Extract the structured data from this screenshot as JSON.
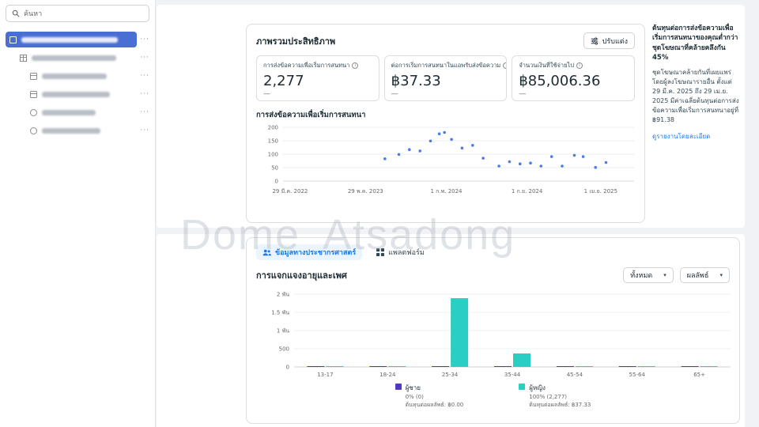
{
  "watermark": "Dome Atsadong",
  "colors": {
    "accent_blue": "#1877f2",
    "selected_row_blue": "#4a6fd4",
    "male_purple": "#5139bf",
    "female_teal": "#2bcec3"
  },
  "sidebar": {
    "search": {
      "placeholder": "ค้นหา"
    },
    "items": [
      {
        "icon": "folder-icon",
        "level": 0,
        "selected": true,
        "menu": "···"
      },
      {
        "icon": "grid-icon",
        "level": 1,
        "selected": false,
        "menu": "···"
      },
      {
        "icon": "adset-icon",
        "level": 2,
        "selected": false,
        "menu": "···"
      },
      {
        "icon": "adset-icon",
        "level": 2,
        "selected": false,
        "menu": "···"
      },
      {
        "icon": "ad-icon",
        "level": 2,
        "selected": false,
        "menu": "···"
      },
      {
        "icon": "ad-icon",
        "level": 2,
        "selected": false,
        "menu": "···"
      }
    ]
  },
  "performance": {
    "title": "ภาพรวมประสิทธิภาพ",
    "customize_button": "ปรับแต่ง",
    "metrics": [
      {
        "label": "การส่งข้อความเพื่อเริ่มการสนทนา",
        "value": "2,277",
        "secondary": "—"
      },
      {
        "label": "ต่อการเริ่มการสนทนาในแอพรับส่งข้อความ",
        "value": "฿37.33",
        "secondary": "—"
      },
      {
        "label": "จำนวนเงินที่ใช้จ่ายไป",
        "value": "฿85,006.36",
        "secondary": "—"
      }
    ],
    "chart_title": "การส่งข้อความเพื่อเริ่มการสนทนา"
  },
  "insight": {
    "headline": "ต้นทุนต่อการส่งข้อความเพื่อเริ่มการสนทนาของคุณต่ำกว่าชุดโฆษณาที่คล้ายคลึงกัน 45%",
    "body": "ชุดโฆษณาคล้ายกันที่เผยแพร่โดยผู้ลงโฆษณารายอื่น ตั้งแต่ 29 มี.ค. 2025 ถึง 29 เม.ย. 2025 มีค่าเฉลี่ยต้นทุนต่อการส่งข้อความเพื่อเริ่มการสนทนาอยู่ที่ ฿91.38",
    "link": "ดูรายงานโดยละเอียด"
  },
  "demographics": {
    "tabs": [
      {
        "label": "ข้อมูลทางประชากรศาสตร์",
        "active": true
      },
      {
        "label": "แพลตฟอร์ม",
        "active": false
      }
    ],
    "title": "การแจกแจงอายุและเพศ",
    "filters": [
      {
        "label": "ทั้งหมด"
      },
      {
        "label": "ผลลัพธ์"
      }
    ],
    "legend": [
      {
        "name": "ผู้ชาย",
        "share": "0% (0)",
        "cost": "ต้นทุนต่อผลลัพธ์: ฿0.00",
        "color": "#5139bf"
      },
      {
        "name": "ผู้หญิง",
        "share": "100% (2,277)",
        "cost": "ต้นทุนต่อผลลัพธ์: ฿37.33",
        "color": "#2bcec3"
      }
    ]
  },
  "chart_data": [
    {
      "type": "scatter",
      "title": "การส่งข้อความเพื่อเริ่มการสนทนา",
      "ylabel": "",
      "ylim": [
        0,
        200
      ],
      "y_ticks": [
        0,
        50,
        100,
        150,
        200
      ],
      "x_tick_labels": [
        "29 มี.ค. 2022",
        "29 พ.ค. 2023",
        "1 ก.พ. 2024",
        "1 ก.ย. 2024",
        "1 เม.ย. 2025"
      ],
      "point_color": "#4b7be5",
      "points": [
        {
          "x": 0.29,
          "y": 83
        },
        {
          "x": 0.33,
          "y": 99
        },
        {
          "x": 0.36,
          "y": 117
        },
        {
          "x": 0.39,
          "y": 112
        },
        {
          "x": 0.42,
          "y": 149
        },
        {
          "x": 0.445,
          "y": 176
        },
        {
          "x": 0.46,
          "y": 181
        },
        {
          "x": 0.48,
          "y": 155
        },
        {
          "x": 0.51,
          "y": 123
        },
        {
          "x": 0.54,
          "y": 133
        },
        {
          "x": 0.57,
          "y": 85
        },
        {
          "x": 0.615,
          "y": 56
        },
        {
          "x": 0.645,
          "y": 72
        },
        {
          "x": 0.675,
          "y": 64
        },
        {
          "x": 0.705,
          "y": 67
        },
        {
          "x": 0.735,
          "y": 56
        },
        {
          "x": 0.765,
          "y": 91
        },
        {
          "x": 0.795,
          "y": 56
        },
        {
          "x": 0.83,
          "y": 96
        },
        {
          "x": 0.855,
          "y": 91
        },
        {
          "x": 0.89,
          "y": 51
        },
        {
          "x": 0.92,
          "y": 69
        }
      ]
    },
    {
      "type": "bar",
      "title": "การแจกแจงอายุและเพศ",
      "categories": [
        "13-17",
        "18-24",
        "25-34",
        "35-44",
        "45-54",
        "55-64",
        "65+"
      ],
      "series": [
        {
          "name": "ผู้ชาย",
          "color": "#5139bf",
          "values": [
            0,
            0,
            0,
            0,
            0,
            0,
            0
          ]
        },
        {
          "name": "ผู้หญิง",
          "color": "#2bcec3",
          "values": [
            4,
            6,
            1890,
            370,
            4,
            2,
            1
          ]
        }
      ],
      "ylim": [
        0,
        2000
      ],
      "y_ticks": [
        {
          "v": 0,
          "label": "0"
        },
        {
          "v": 500,
          "label": "500"
        },
        {
          "v": 1000,
          "label": "1 พัน"
        },
        {
          "v": 1500,
          "label": "1.5 พัน"
        },
        {
          "v": 2000,
          "label": "2 พัน"
        }
      ]
    }
  ]
}
